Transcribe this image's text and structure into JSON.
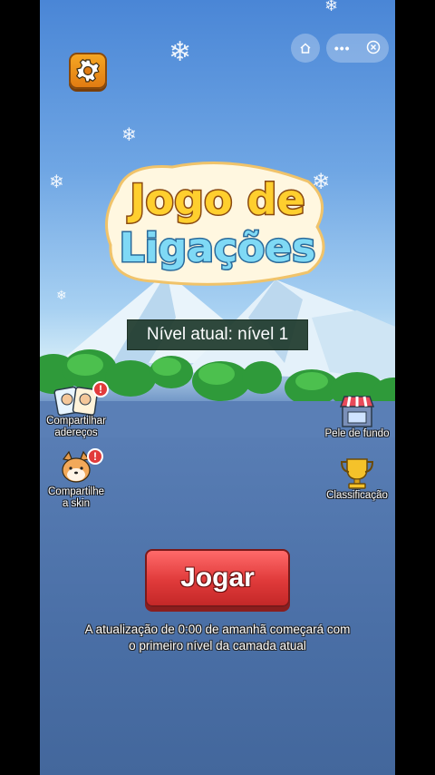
{
  "logo": {
    "line1": "Jogo de",
    "line2": "Ligações"
  },
  "level": {
    "text": "Nível atual: nível 1"
  },
  "left_buttons": [
    {
      "label_line1": "Compartilhar",
      "label_line2": "adereços",
      "badge": "!"
    },
    {
      "label_line1": "Compartilhe",
      "label_line2": "a skin",
      "badge": "!"
    }
  ],
  "right_buttons": [
    {
      "label": "Pele de fundo"
    },
    {
      "label": "Classificação"
    }
  ],
  "play_button": {
    "label": "Jogar"
  },
  "notice": {
    "line1": "A atualização de 0:00 de amanhã começará com",
    "line2": "o primeiro nível da camada atual"
  },
  "capsule": {
    "more_icon": "more-dots-icon",
    "close_icon": "close-circle-icon",
    "home_icon": "home-icon"
  },
  "colors": {
    "play": "#e03a3a",
    "settings": "#f5a623",
    "level_bg": "#1f3a2c"
  }
}
